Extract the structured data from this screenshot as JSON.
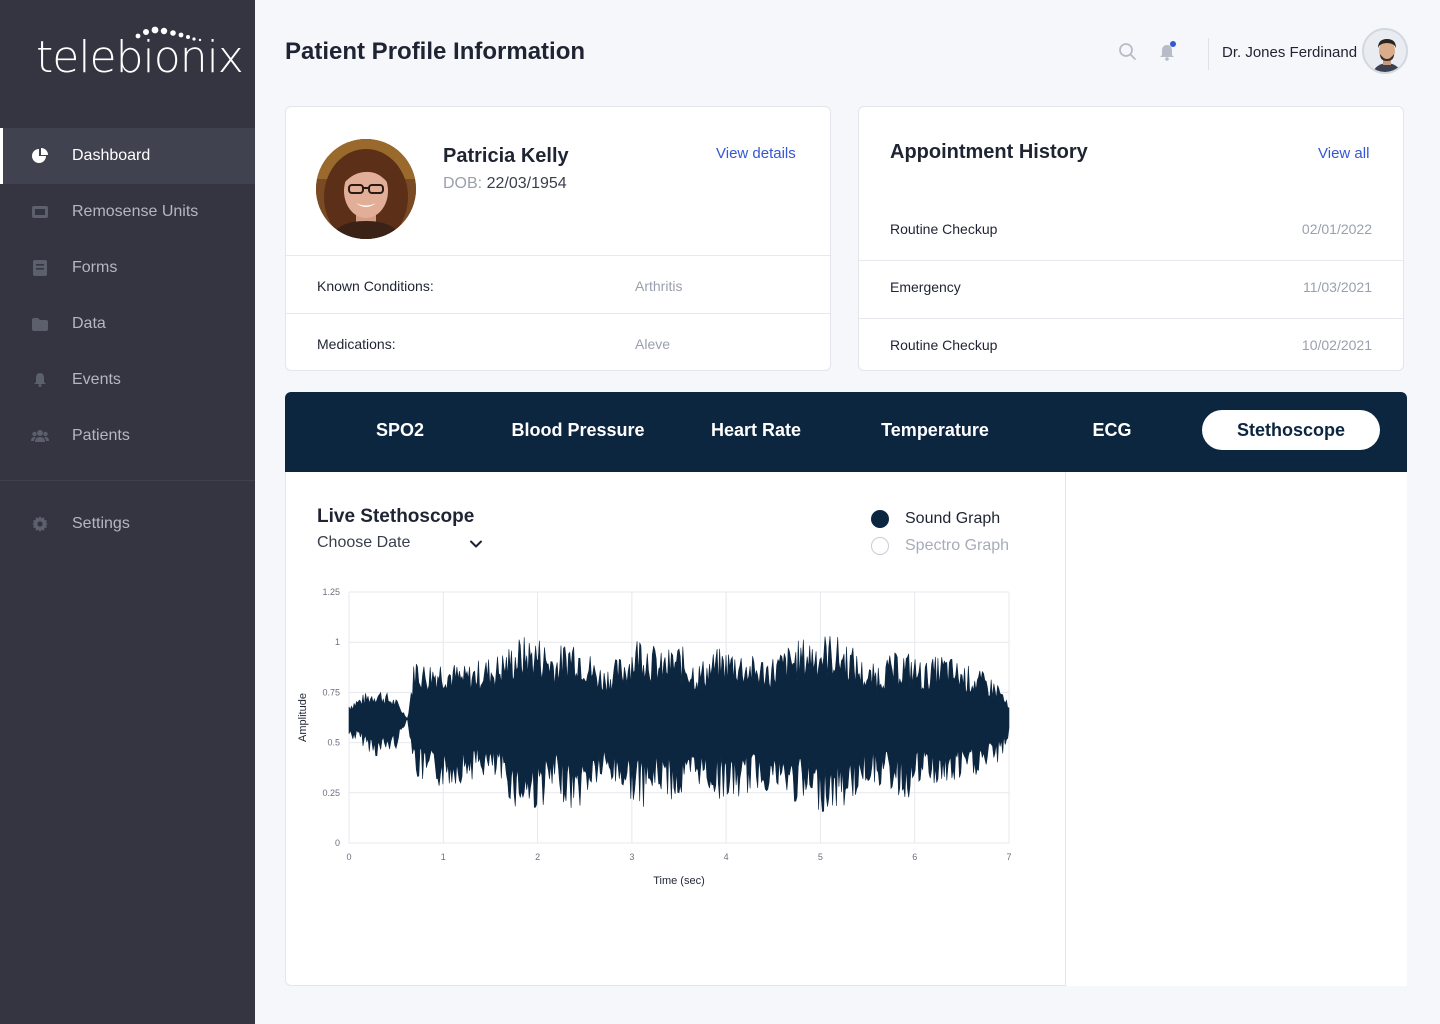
{
  "app": {
    "logo_text": "telebionix"
  },
  "sidebar": {
    "items": [
      {
        "label": "Dashboard",
        "icon": "pie-chart-icon",
        "active": true
      },
      {
        "label": "Remosense Units",
        "icon": "device-icon",
        "active": false
      },
      {
        "label": "Forms",
        "icon": "document-icon",
        "active": false
      },
      {
        "label": "Data",
        "icon": "folder-icon",
        "active": false
      },
      {
        "label": "Events",
        "icon": "bell-icon",
        "active": false
      },
      {
        "label": "Patients",
        "icon": "users-icon",
        "active": false
      }
    ],
    "settings": {
      "label": "Settings",
      "icon": "gear-icon"
    }
  },
  "header": {
    "title": "Patient Profile Information",
    "user_name": "Dr. Jones Ferdinand"
  },
  "patient": {
    "name": "Patricia Kelly",
    "dob_label": "DOB:",
    "dob": "22/03/1954",
    "view_details": "View details",
    "known_conditions_label": "Known Conditions:",
    "known_conditions": "Arthritis",
    "medications_label": "Medications:",
    "medications": "Aleve"
  },
  "appointments": {
    "title": "Appointment History",
    "view_all": "View all",
    "rows": [
      {
        "type": "Routine Checkup",
        "date": "02/01/2022"
      },
      {
        "type": "Emergency",
        "date": "11/03/2021"
      },
      {
        "type": "Routine Checkup",
        "date": "10/02/2021"
      }
    ]
  },
  "tabs": [
    {
      "label": "SPO2",
      "active": false
    },
    {
      "label": "Blood Pressure",
      "active": false
    },
    {
      "label": "Heart Rate",
      "active": false
    },
    {
      "label": "Temperature",
      "active": false
    },
    {
      "label": "ECG",
      "active": false
    },
    {
      "label": "Stethoscope",
      "active": true
    }
  ],
  "chart_panel": {
    "title": "Live Stethoscope",
    "date_select": "Choose Date",
    "graph_options": [
      {
        "label": "Sound Graph",
        "selected": true
      },
      {
        "label": "Spectro Graph",
        "selected": false
      }
    ]
  },
  "chart_data": {
    "type": "area",
    "xlabel": "Time (sec)",
    "ylabel": "Amplitude",
    "xlim": [
      0,
      7
    ],
    "ylim": [
      0,
      1.25
    ],
    "x_ticks": [
      "0",
      "1",
      "2",
      "3",
      "4",
      "5",
      "6",
      "7"
    ],
    "y_ticks": [
      "0",
      "0.25",
      "0.5",
      "0.75",
      "1",
      "1.25"
    ],
    "grid": true,
    "baseline": 0.62,
    "series": [
      {
        "color": "#0d2640",
        "envelope_x": [
          0,
          0.1,
          0.3,
          0.5,
          0.62,
          0.7,
          0.8,
          1.0,
          1.2,
          1.4,
          1.6,
          1.8,
          2.0,
          2.2,
          2.4,
          2.6,
          2.7,
          2.9,
          3.1,
          3.3,
          3.5,
          3.7,
          3.9,
          4.1,
          4.3,
          4.5,
          4.7,
          4.9,
          5.1,
          5.3,
          5.5,
          5.7,
          5.9,
          6.1,
          6.3,
          6.5,
          6.7,
          6.9,
          7.0
        ],
        "envelope_upper": [
          0.7,
          0.73,
          0.78,
          0.72,
          0.62,
          0.95,
          0.9,
          0.93,
          0.88,
          0.92,
          0.95,
          1.03,
          1.04,
          0.97,
          1.06,
          0.92,
          0.88,
          0.94,
          1.07,
          0.95,
          1.0,
          0.9,
          0.97,
          0.98,
          0.93,
          0.94,
          1.0,
          1.04,
          1.05,
          1.01,
          0.88,
          0.93,
          0.97,
          0.9,
          0.95,
          0.9,
          0.86,
          0.8,
          0.68
        ],
        "envelope_lower": [
          0.52,
          0.5,
          0.42,
          0.47,
          0.62,
          0.32,
          0.28,
          0.27,
          0.3,
          0.33,
          0.28,
          0.15,
          0.16,
          0.24,
          0.14,
          0.27,
          0.3,
          0.25,
          0.17,
          0.25,
          0.19,
          0.29,
          0.22,
          0.2,
          0.26,
          0.25,
          0.2,
          0.16,
          0.15,
          0.18,
          0.3,
          0.27,
          0.2,
          0.3,
          0.26,
          0.3,
          0.34,
          0.4,
          0.52
        ]
      }
    ]
  }
}
